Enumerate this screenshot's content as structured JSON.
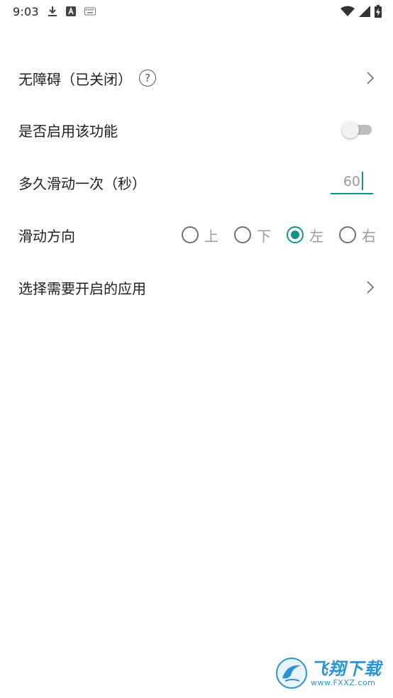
{
  "status_bar": {
    "time": "9:03",
    "icons_left": [
      "download-icon",
      "text-a-icon",
      "keyboard-icon"
    ],
    "icons_right": [
      "wifi-icon",
      "signal-icon",
      "battery-charging-icon"
    ]
  },
  "settings": {
    "accessibility": {
      "label": "无障碍（已关闭）",
      "help": "?"
    },
    "enable": {
      "label": "是否启用该功能",
      "enabled": false
    },
    "interval": {
      "label": "多久滑动一次（秒）",
      "value": "60"
    },
    "direction": {
      "label": "滑动方向",
      "options": [
        "上",
        "下",
        "左",
        "右"
      ],
      "selected": "左"
    },
    "apps": {
      "label": "选择需要开启的应用"
    }
  },
  "watermark": {
    "cn": "飞翔下载",
    "en": "www.FXXZ.com"
  },
  "colors": {
    "accent": "#119383",
    "watermark": "#2b93d4"
  }
}
